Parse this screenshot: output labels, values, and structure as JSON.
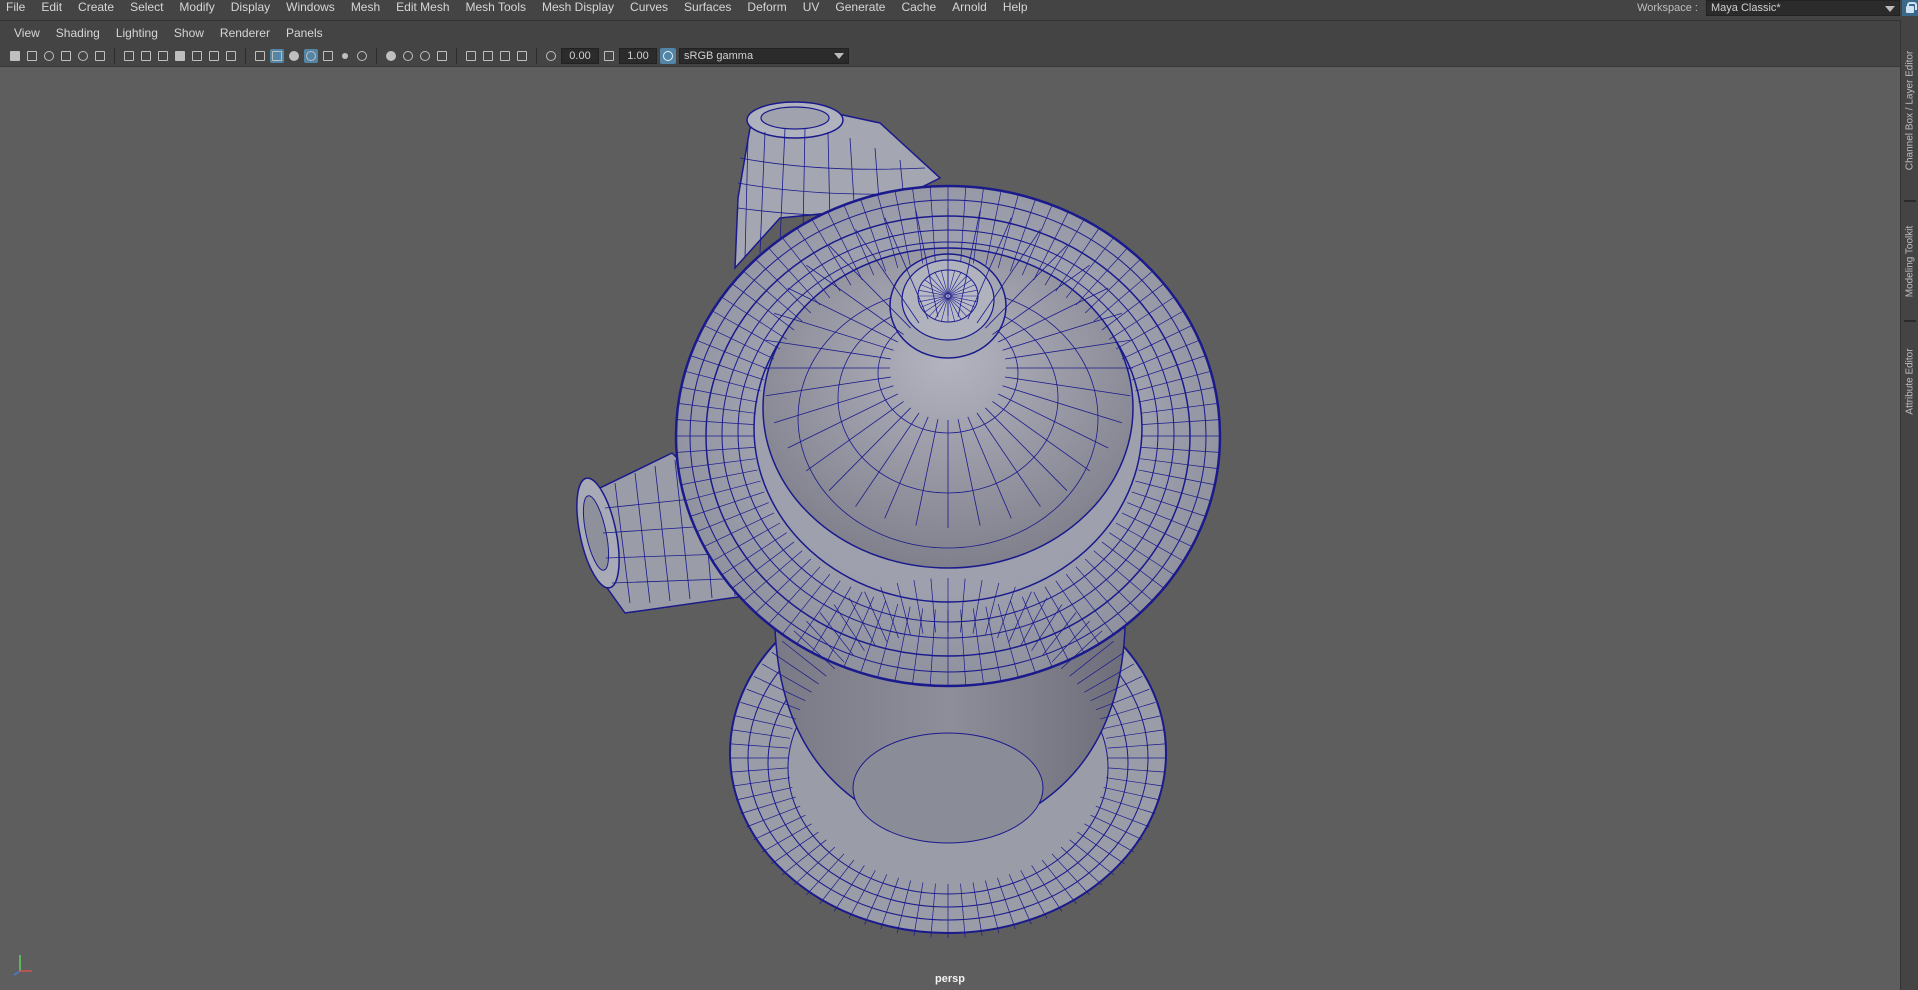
{
  "main_menu": {
    "items": [
      "File",
      "Edit",
      "Create",
      "Select",
      "Modify",
      "Display",
      "Windows",
      "Mesh",
      "Edit Mesh",
      "Mesh Tools",
      "Mesh Display",
      "Curves",
      "Surfaces",
      "Deform",
      "UV",
      "Generate",
      "Cache",
      "Arnold",
      "Help"
    ]
  },
  "workspace": {
    "label": "Workspace :",
    "value": "Maya Classic*"
  },
  "panel_menu": {
    "items": [
      "View",
      "Shading",
      "Lighting",
      "Show",
      "Renderer",
      "Panels"
    ]
  },
  "toolbar": {
    "exposure": "0.00",
    "gamma": "1.00",
    "color_space": "sRGB gamma",
    "icons": [
      "camera-icon",
      "lock-camera-icon",
      "bookmark-icon",
      "image-plane-icon",
      "2d-pan-zoom-icon",
      "grease-pencil-icon",
      "grid-icon",
      "film-gate-icon",
      "resolution-gate-icon",
      "gate-mask-icon",
      "field-chart-icon",
      "safe-action-icon",
      "safe-title-icon",
      "wireframe-icon",
      "smooth-shade-all-icon",
      "default-material-icon",
      "wireframe-on-shaded-icon",
      "textured-icon",
      "use-all-lights-icon",
      "shadows-icon",
      "screen-space-ao-icon",
      "motion-blur-icon",
      "anti-aliasing-icon",
      "depth-of-field-icon",
      "isolate-select-icon",
      "xray-icon",
      "xray-joints-icon",
      "xray-components-icon",
      "hud-icon"
    ]
  },
  "viewport": {
    "camera_label": "persp",
    "model": "fire-hydrant-wireframe-on-shaded",
    "wire_color": "#1a1a8c",
    "surface_color": "#9a9aa8",
    "background_color": "#5e5e5e"
  },
  "side_dock": {
    "tabs": [
      "Channel Box / Layer Editor",
      "Modeling Toolkit",
      "Attribute Editor"
    ]
  },
  "colors": {
    "ui_background": "#444444",
    "accent": "#5285a6"
  }
}
